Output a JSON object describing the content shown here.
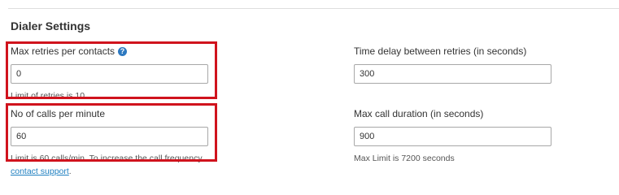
{
  "section": {
    "title": "Dialer Settings"
  },
  "max_retries": {
    "label": "Max retries per contacts",
    "help_icon": "question-circle-icon",
    "value": "0",
    "hint": "Limit of retries is 10"
  },
  "time_delay": {
    "label": "Time delay between retries (in seconds)",
    "value": "300"
  },
  "calls_per_minute": {
    "label": "No of calls per minute",
    "value": "60",
    "hint": "Limit is 60 calls/min. To increase the call frequency",
    "link_text": "contact support",
    "link_suffix": "."
  },
  "max_call_duration": {
    "label": "Max call duration (in seconds)",
    "value": "900",
    "hint": "Max Limit is 7200 seconds"
  },
  "colors": {
    "highlight": "#d0131d",
    "link": "#1e7fc0",
    "help_icon": "#2d79c0"
  }
}
